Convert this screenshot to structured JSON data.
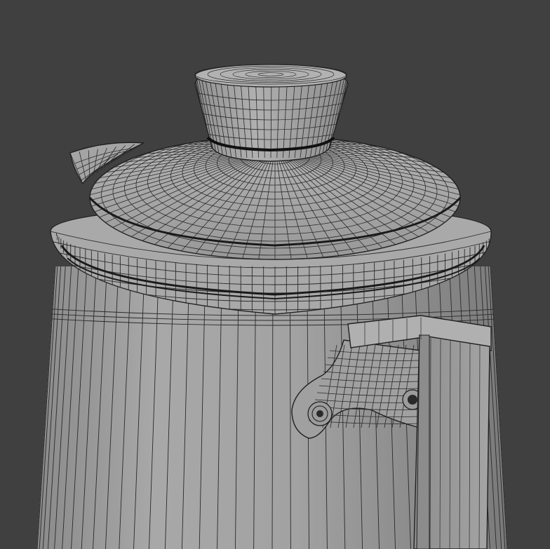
{
  "viewport": {
    "background_color": "#404040",
    "mesh_fill_color": "#a6a6a6",
    "mesh_shadow_color": "#7e7e7e",
    "wire_color": "#202020",
    "display_mode": "wireframe-overlay"
  },
  "model": {
    "parts": [
      "knob",
      "lid",
      "rim",
      "body",
      "spout",
      "handle",
      "handle-bracket",
      "rivets"
    ]
  }
}
